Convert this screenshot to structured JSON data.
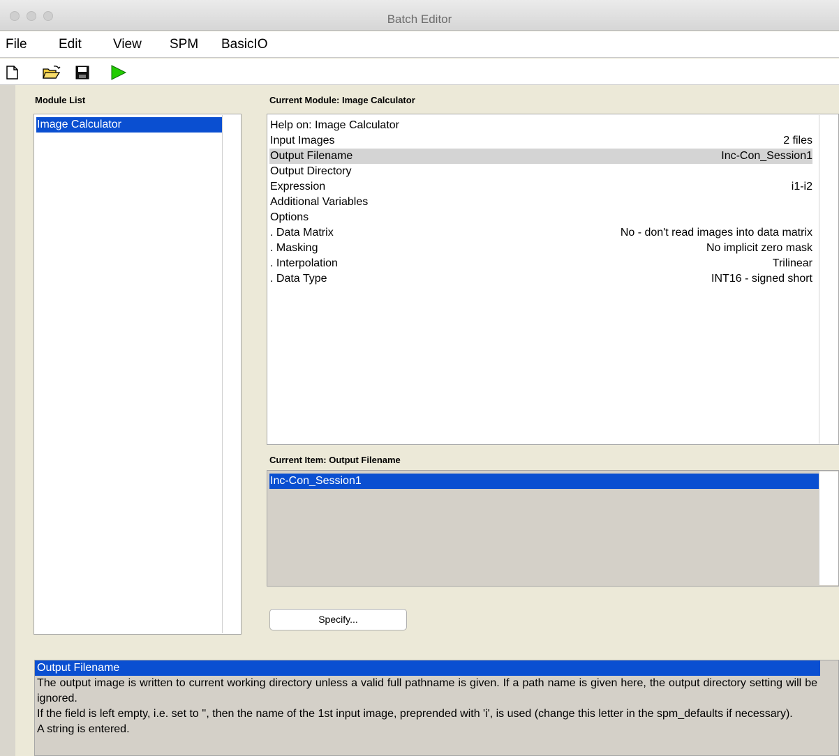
{
  "window": {
    "title": "Batch Editor"
  },
  "menu": [
    "File",
    "Edit",
    "View",
    "SPM",
    "BasicIO"
  ],
  "toolbar": {
    "new_icon": "new-file-icon",
    "open_icon": "open-folder-icon",
    "save_icon": "save-disk-icon",
    "run_icon": "run-play-icon",
    "run_color": "#22cc00"
  },
  "module_list": {
    "label": "Module List",
    "items": [
      "Image Calculator"
    ]
  },
  "current_module": {
    "label": "Current Module: Image Calculator",
    "items": [
      {
        "name": "Help on: Image Calculator",
        "value": ""
      },
      {
        "name": "Input Images",
        "value": "2 files"
      },
      {
        "name": "Output Filename",
        "value": "Inc-Con_Session1"
      },
      {
        "name": "Output Directory",
        "value": ""
      },
      {
        "name": "Expression",
        "value": "i1-i2"
      },
      {
        "name": "Additional Variables",
        "value": ""
      },
      {
        "name": "Options",
        "value": ""
      },
      {
        "name": ". Data Matrix",
        "value": "No - don't read images into data matrix"
      },
      {
        "name": ". Masking",
        "value": "No implicit zero mask"
      },
      {
        "name": ". Interpolation",
        "value": "Trilinear"
      },
      {
        "name": ". Data Type",
        "value": "INT16   - signed short"
      }
    ]
  },
  "current_item": {
    "label": "Current Item: Output Filename",
    "value": "Inc-Con_Session1"
  },
  "specify_button": "Specify...",
  "help": {
    "title": "Output Filename",
    "paragraphs": [
      "The output image is written to current working directory unless a valid full pathname is given. If a path name is given here, the output directory setting will be ignored.",
      "If the field is left empty, i.e. set to '', then the name of the 1st input image, preprended with 'i', is used (change this letter in the spm_defaults if necessary).",
      "A string is entered."
    ]
  },
  "colors": {
    "selection": "#0a4fd1",
    "highlight": "#d4d4d4",
    "panel_bg": "#ece9d8"
  }
}
